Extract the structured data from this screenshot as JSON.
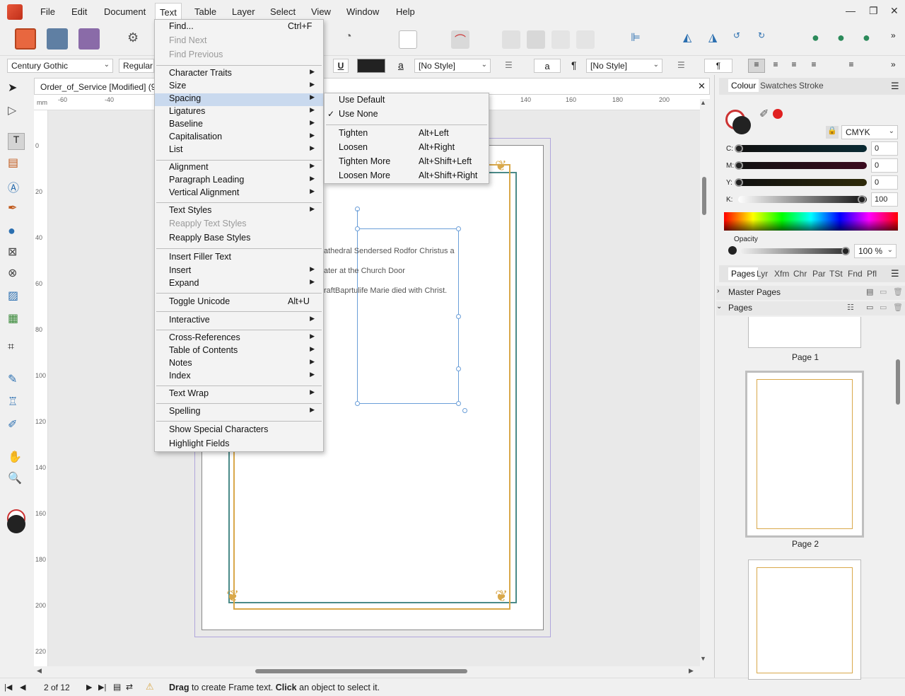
{
  "menubar": {
    "items": [
      "File",
      "Edit",
      "Document",
      "Text",
      "Table",
      "Layer",
      "Select",
      "View",
      "Window",
      "Help"
    ],
    "window_controls": {
      "minimize": "—",
      "restore": "❐",
      "close": "✕"
    }
  },
  "context": {
    "font_family": "Century Gothic",
    "font_style": "Regular",
    "underline_label": "U",
    "char_style": "[No Style]",
    "para_style": "[No Style]",
    "a_label": "a",
    "pilcrow": "¶"
  },
  "document": {
    "tab_title": "Order_of_Service [Modified] (96.0",
    "ruler_h": [
      "-60",
      "-40",
      "140",
      "160",
      "180",
      "200"
    ],
    "ruler_v": [
      "0",
      "20",
      "40",
      "60",
      "80",
      "100",
      "120",
      "140",
      "160",
      "180",
      "200",
      "220"
    ],
    "ruler_unit": "mm",
    "frame_lines": [
      "athedral Sendersed Rodfor Christus a",
      "ater at the Church Door",
      "raftBaprtulife Marie died with Christ."
    ]
  },
  "status": {
    "page_indicator": "2 of 12",
    "hint_b1": "Drag",
    "hint_t1": " to create Frame text. ",
    "hint_b2": "Click",
    "hint_t2": " an object to select it."
  },
  "colour_panel": {
    "tabs": [
      "Colour",
      "Swatches",
      "Stroke"
    ],
    "mode": "CMYK",
    "channels": [
      {
        "label": "C:",
        "value": "0"
      },
      {
        "label": "M:",
        "value": "0"
      },
      {
        "label": "Y:",
        "value": "0"
      },
      {
        "label": "K:",
        "value": "100"
      }
    ],
    "opacity_label": "Opacity",
    "opacity_value": "100 %"
  },
  "pages_panel": {
    "tabs": [
      "Pages",
      "Lyr",
      "Xfm",
      "Chr",
      "Par",
      "TSt",
      "Fnd",
      "Pfl"
    ],
    "master_pages": "Master Pages",
    "pages": "Pages",
    "page_labels": [
      "Page 1",
      "Page 2"
    ]
  },
  "text_menu": {
    "items": [
      {
        "label": "Find...",
        "shortcut": "Ctrl+F"
      },
      {
        "label": "Find Next",
        "disabled": true
      },
      {
        "label": "Find Previous",
        "disabled": true
      },
      {
        "label": "Character Traits",
        "sub": true
      },
      {
        "label": "Size",
        "sub": true
      },
      {
        "label": "Spacing",
        "sub": true,
        "highlight": true
      },
      {
        "label": "Ligatures",
        "sub": true
      },
      {
        "label": "Baseline",
        "sub": true
      },
      {
        "label": "Capitalisation",
        "sub": true
      },
      {
        "label": "List",
        "sub": true
      },
      {
        "label": "Alignment",
        "sub": true
      },
      {
        "label": "Paragraph Leading",
        "sub": true
      },
      {
        "label": "Vertical Alignment",
        "sub": true
      },
      {
        "label": "Text Styles",
        "sub": true
      },
      {
        "label": "Reapply Text Styles",
        "disabled": true
      },
      {
        "label": "Reapply Base Styles"
      },
      {
        "label": "Insert Filler Text"
      },
      {
        "label": "Insert",
        "sub": true
      },
      {
        "label": "Expand",
        "sub": true
      },
      {
        "label": "Toggle Unicode",
        "shortcut": "Alt+U"
      },
      {
        "label": "Interactive",
        "sub": true
      },
      {
        "label": "Cross-References",
        "sub": true
      },
      {
        "label": "Table of Contents",
        "sub": true
      },
      {
        "label": "Notes",
        "sub": true
      },
      {
        "label": "Index",
        "sub": true
      },
      {
        "label": "Text Wrap",
        "sub": true
      },
      {
        "label": "Spelling",
        "sub": true
      },
      {
        "label": "Show Special Characters"
      },
      {
        "label": "Highlight Fields"
      }
    ]
  },
  "spacing_menu": {
    "items": [
      {
        "label": "Use Default"
      },
      {
        "label": "Use None",
        "checked": true
      },
      {
        "label": "Tighten",
        "shortcut": "Alt+Left"
      },
      {
        "label": "Loosen",
        "shortcut": "Alt+Right"
      },
      {
        "label": "Tighten More",
        "shortcut": "Alt+Shift+Left"
      },
      {
        "label": "Loosen More",
        "shortcut": "Alt+Shift+Right"
      }
    ]
  },
  "colors": {
    "accent": "#c9d9ee",
    "gold": "#d9a84a",
    "selection": "#6a9ed8",
    "logo": "#e8573a"
  }
}
